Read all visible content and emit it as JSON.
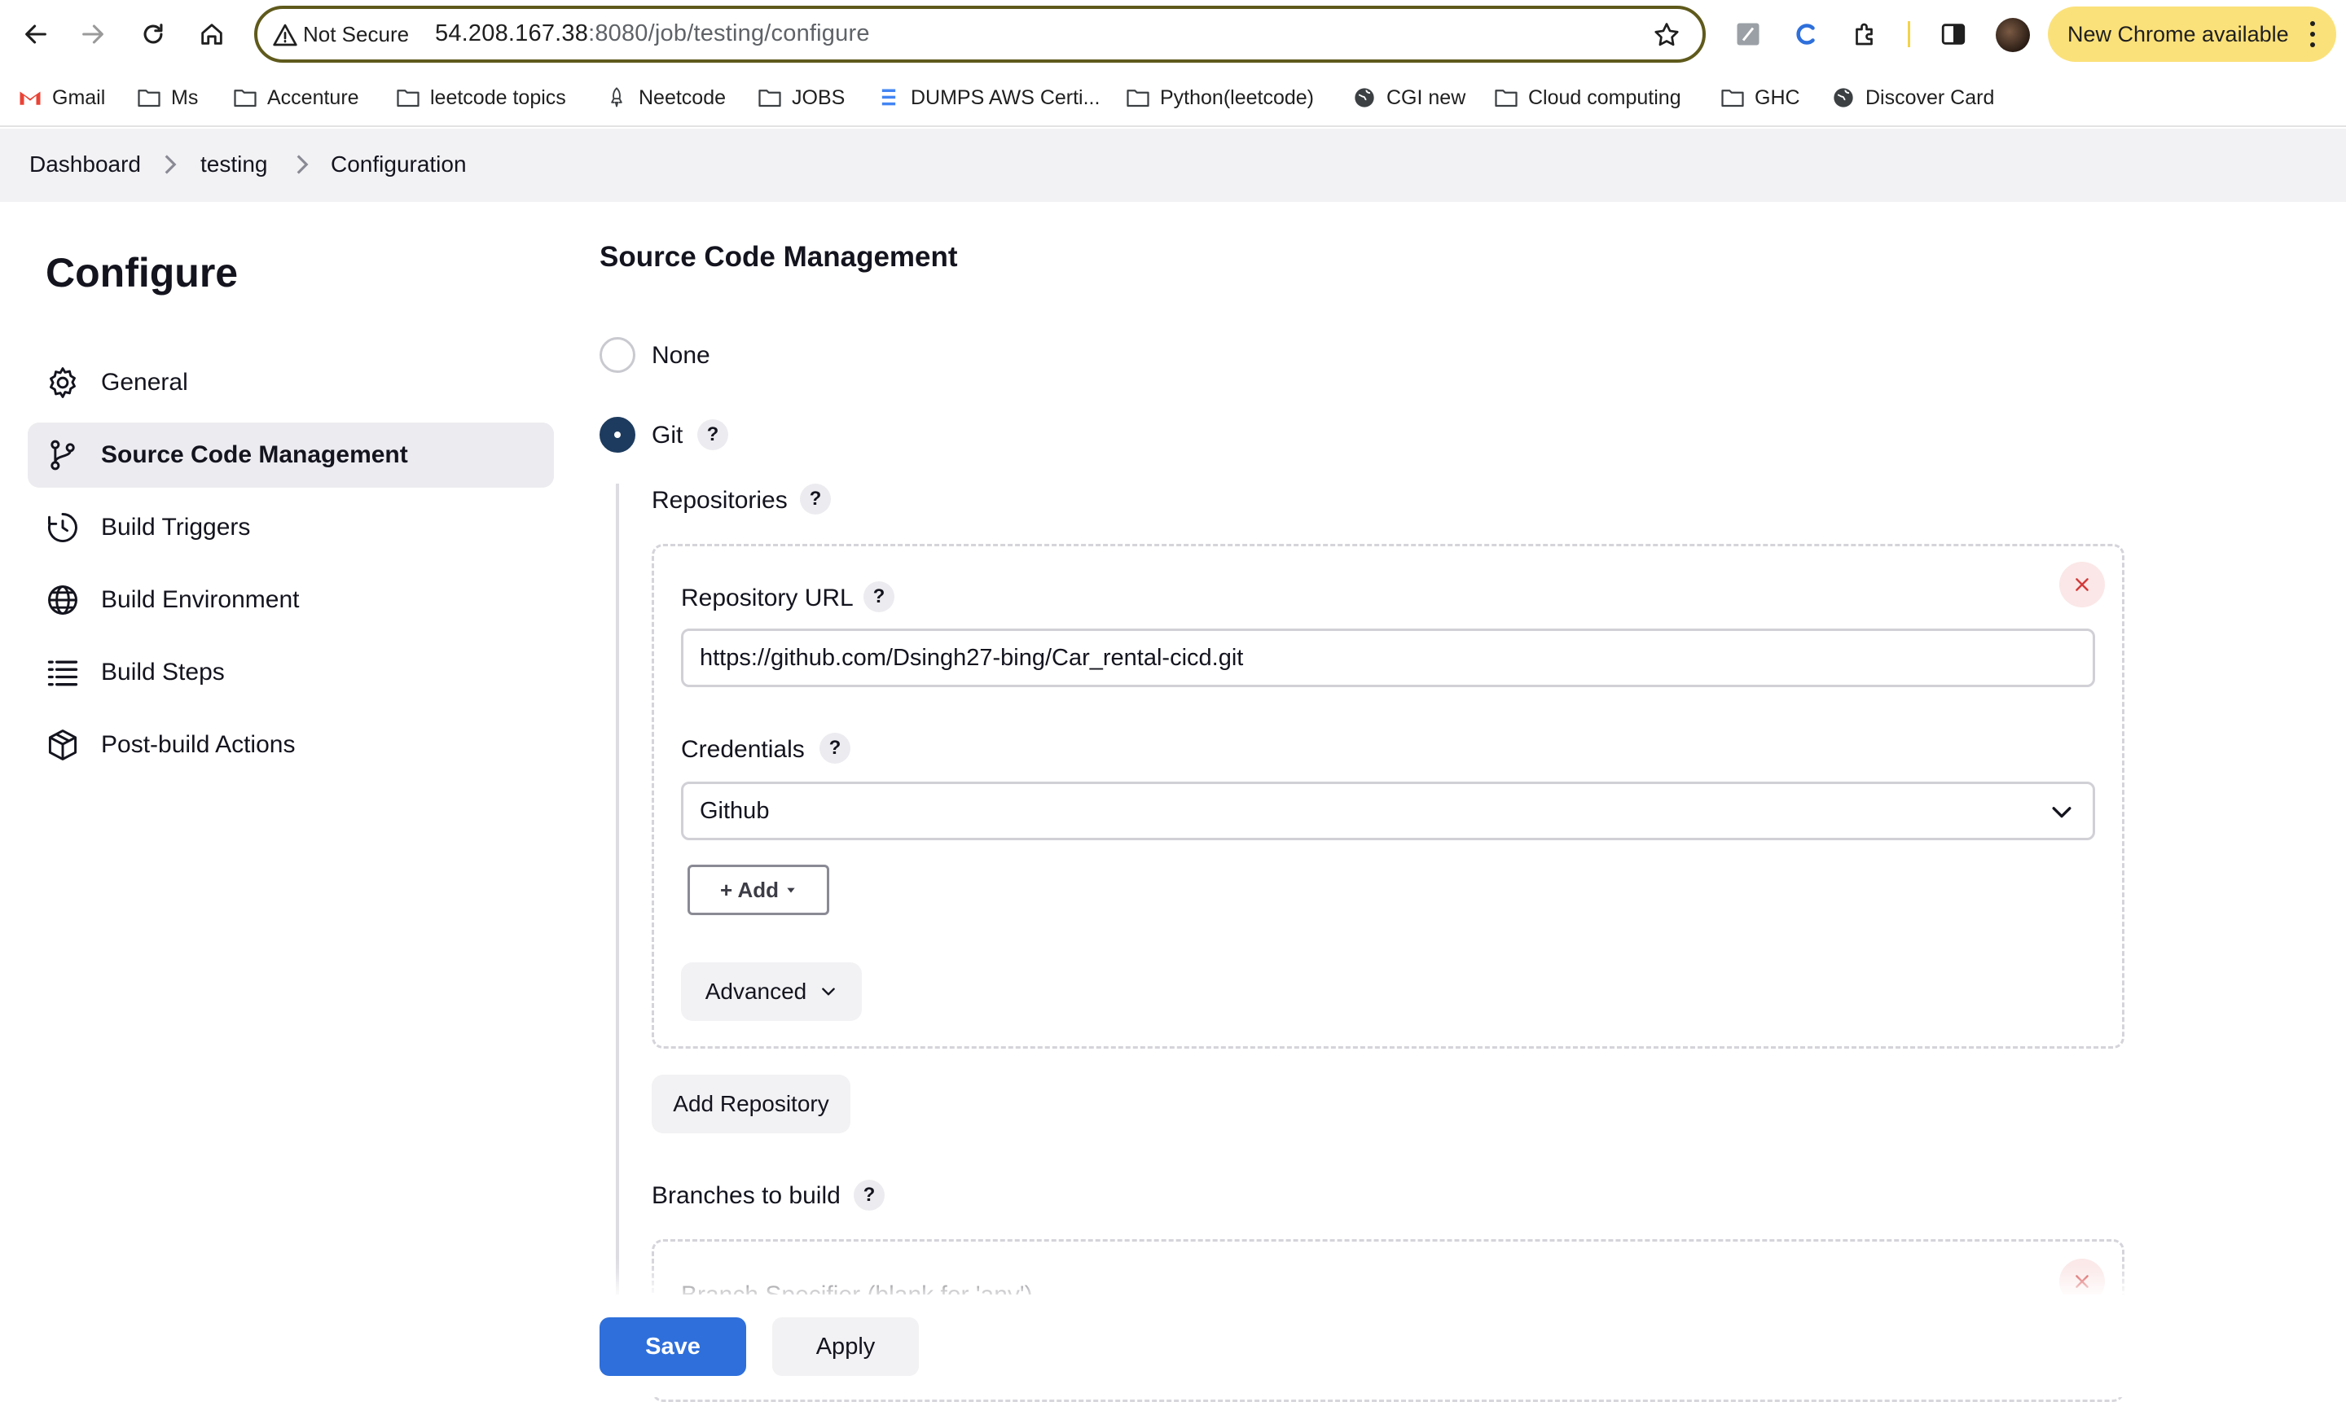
{
  "browser": {
    "security_label": "Not Secure",
    "url_host": "54.208.167.38",
    "url_rest": ":8080/job/testing/configure",
    "update_label": "New Chrome available",
    "update_color": "#fbe17a",
    "bookmarks": [
      {
        "label": "Gmail",
        "icon": "gmail-icon"
      },
      {
        "label": "Ms",
        "icon": "folder-icon"
      },
      {
        "label": "Accenture",
        "icon": "folder-icon"
      },
      {
        "label": "leetcode topics",
        "icon": "folder-icon"
      },
      {
        "label": "Neetcode",
        "icon": "rocket-icon"
      },
      {
        "label": "JOBS",
        "icon": "folder-icon"
      },
      {
        "label": "DUMPS AWS Certi...",
        "icon": "doc-icon"
      },
      {
        "label": "Python(leetcode)",
        "icon": "folder-icon"
      },
      {
        "label": "CGI new",
        "icon": "globe-icon"
      },
      {
        "label": "Cloud computing",
        "icon": "folder-icon"
      },
      {
        "label": "GHC",
        "icon": "folder-icon"
      },
      {
        "label": "Discover Card",
        "icon": "globe-icon"
      }
    ]
  },
  "breadcrumb": [
    "Dashboard",
    "testing",
    "Configuration"
  ],
  "sidebar": {
    "title": "Configure",
    "items": [
      {
        "label": "General",
        "icon": "gear-icon",
        "active": false
      },
      {
        "label": "Source Code Management",
        "icon": "branch-icon",
        "active": true
      },
      {
        "label": "Build Triggers",
        "icon": "clock-icon",
        "active": false
      },
      {
        "label": "Build Environment",
        "icon": "globe-icon",
        "active": false
      },
      {
        "label": "Build Steps",
        "icon": "list-icon",
        "active": false
      },
      {
        "label": "Post-build Actions",
        "icon": "package-icon",
        "active": false
      }
    ]
  },
  "scm": {
    "title": "Source Code Management",
    "option_none": "None",
    "option_git": "Git",
    "selected": "Git",
    "repositories_label": "Repositories",
    "repo_url_label": "Repository URL",
    "repo_url_value": "https://github.com/Dsingh27-bing/Car_rental-cicd.git",
    "credentials_label": "Credentials",
    "credentials_value": "Github",
    "add_label": "+ Add",
    "advanced_label": "Advanced",
    "add_repository_label": "Add Repository",
    "branches_label": "Branches to build",
    "branch_specifier_label": "Branch Specifier (blank for 'any')"
  },
  "footer": {
    "save_label": "Save",
    "apply_label": "Apply",
    "save_color": "#2e6fdb"
  }
}
